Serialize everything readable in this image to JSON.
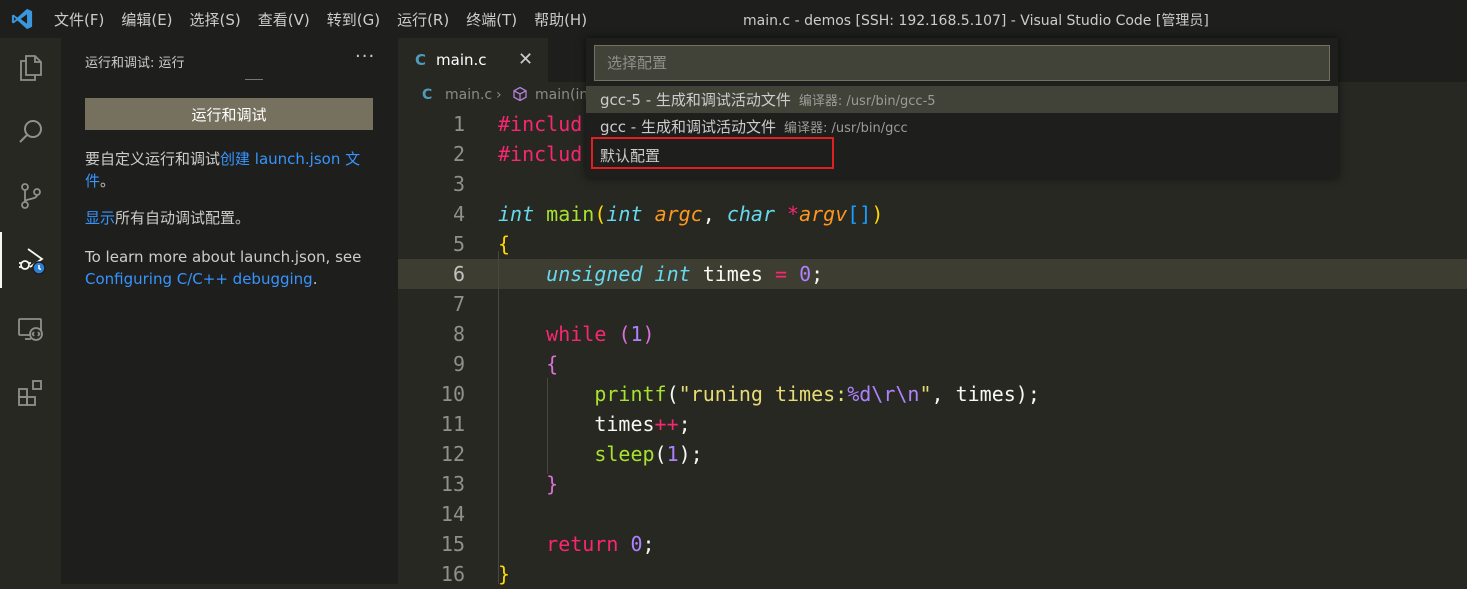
{
  "window": {
    "title": "main.c - demos [SSH: 192.168.5.107] - Visual Studio Code [管理员]"
  },
  "menu": [
    "文件(F)",
    "编辑(E)",
    "选择(S)",
    "查看(V)",
    "转到(G)",
    "运行(R)",
    "终端(T)",
    "帮助(H)"
  ],
  "activity_bar": [
    {
      "icon": "files-icon"
    },
    {
      "icon": "search-icon"
    },
    {
      "icon": "source-control-icon"
    },
    {
      "icon": "run-debug-icon",
      "active": true
    },
    {
      "icon": "remote-explorer-icon"
    },
    {
      "icon": "extensions-icon"
    }
  ],
  "sidebar": {
    "title": "运行和调试: 运行",
    "more": "···",
    "run_button": "运行和调试",
    "para1": {
      "before": "要自定义运行和调试",
      "link": "创建 launch.json 文件",
      "after": "。"
    },
    "para2": {
      "link": "显示",
      "after": "所有自动调试配置。"
    },
    "para3": {
      "text": "To learn more about launch.json, see",
      "link": "Configuring C/C++ debugging",
      "after": "."
    }
  },
  "tab": {
    "icon": "C",
    "name": "main.c",
    "close": "✕"
  },
  "breadcrumb": {
    "file": "main.c",
    "symbol": "main(in"
  },
  "quick_pick": {
    "placeholder": "选择配置",
    "items": [
      {
        "label": "gcc-5 - 生成和调试活动文件",
        "description": "编译器: /usr/bin/gcc-5",
        "selected": true
      },
      {
        "label": "gcc - 生成和调试活动文件",
        "description": "编译器: /usr/bin/gcc"
      },
      {
        "label": "默认配置",
        "description": "",
        "highlighted": true
      }
    ]
  },
  "editor": {
    "current_line": 6,
    "lines": [
      {
        "n": "1",
        "tokens": [
          [
            "k",
            "#includ"
          ]
        ]
      },
      {
        "n": "2",
        "tokens": [
          [
            "k",
            "#includ"
          ]
        ]
      },
      {
        "n": "3",
        "tokens": []
      },
      {
        "n": "4",
        "tokens": [
          [
            "t",
            "int"
          ],
          [
            "pr",
            " "
          ],
          [
            "f",
            "main"
          ],
          [
            "b1",
            "("
          ],
          [
            "t",
            "int"
          ],
          [
            "pr",
            " "
          ],
          [
            "p",
            "argc"
          ],
          [
            "pr",
            ", "
          ],
          [
            "t",
            "char"
          ],
          [
            "pr",
            " "
          ],
          [
            "op",
            "*"
          ],
          [
            "p",
            "argv"
          ],
          [
            "b3",
            "[]"
          ],
          [
            "b1",
            ")"
          ]
        ]
      },
      {
        "n": "5",
        "tokens": [
          [
            "b1",
            "{"
          ]
        ]
      },
      {
        "n": "6",
        "tokens": [
          [
            "pr",
            "    "
          ],
          [
            "t",
            "unsigned"
          ],
          [
            "pr",
            " "
          ],
          [
            "t",
            "int"
          ],
          [
            "pr",
            " times "
          ],
          [
            "op",
            "="
          ],
          [
            "pr",
            " "
          ],
          [
            "n",
            "0"
          ],
          [
            "pr",
            ";"
          ]
        ]
      },
      {
        "n": "7",
        "tokens": []
      },
      {
        "n": "8",
        "tokens": [
          [
            "pr",
            "    "
          ],
          [
            "k",
            "while"
          ],
          [
            "pr",
            " "
          ],
          [
            "b2",
            "("
          ],
          [
            "n",
            "1"
          ],
          [
            "b2",
            ")"
          ]
        ]
      },
      {
        "n": "9",
        "tokens": [
          [
            "pr",
            "    "
          ],
          [
            "b2",
            "{"
          ]
        ]
      },
      {
        "n": "10",
        "tokens": [
          [
            "pr",
            "        "
          ],
          [
            "f",
            "printf"
          ],
          [
            "pr",
            "("
          ],
          [
            "s",
            "\"runing times:"
          ],
          [
            "n",
            "%d\\r\\n"
          ],
          [
            "s",
            "\""
          ],
          [
            "pr",
            ", times);"
          ]
        ]
      },
      {
        "n": "11",
        "tokens": [
          [
            "pr",
            "        times"
          ],
          [
            "op",
            "++"
          ],
          [
            "pr",
            ";"
          ]
        ]
      },
      {
        "n": "12",
        "tokens": [
          [
            "pr",
            "        "
          ],
          [
            "f",
            "sleep"
          ],
          [
            "pr",
            "("
          ],
          [
            "n",
            "1"
          ],
          [
            "pr",
            ");"
          ]
        ]
      },
      {
        "n": "13",
        "tokens": [
          [
            "pr",
            "    "
          ],
          [
            "b2",
            "}"
          ]
        ]
      },
      {
        "n": "14",
        "tokens": []
      },
      {
        "n": "15",
        "tokens": [
          [
            "pr",
            "    "
          ],
          [
            "k",
            "return"
          ],
          [
            "pr",
            " "
          ],
          [
            "n",
            "0"
          ],
          [
            "pr",
            ";"
          ]
        ]
      },
      {
        "n": "16",
        "tokens": [
          [
            "b1",
            "}"
          ]
        ]
      }
    ]
  },
  "colors": {
    "accent": "#3794ff",
    "highlight_box": "#e02020",
    "button": "#75715e"
  }
}
